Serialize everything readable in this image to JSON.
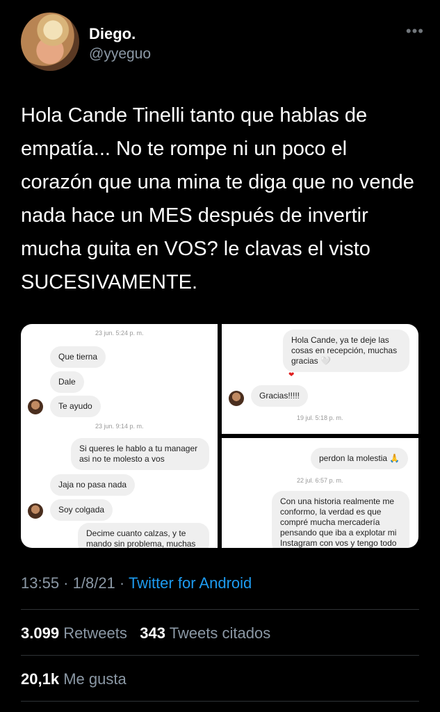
{
  "tweet": {
    "author_name": "Diego.",
    "author_handle": "@yyeguo",
    "more_icon": "more-horizontal-icon",
    "text": "Hola Cande Tinelli tanto que hablas de empatía... No te rompe ni un poco el corazón que una mina te diga que no vende nada hace un MES después de invertir mucha guita en VOS? le clavas el visto SUCESIVAMENTE.",
    "time": "13:55",
    "date": "1/8/21",
    "source": "Twitter for Android",
    "retweets_count": "3.099",
    "retweets_label": "Retweets",
    "quotes_count": "343",
    "quotes_label": "Tweets citados",
    "likes_count": "20,1k",
    "likes_label": "Me gusta"
  },
  "screenshot_a": {
    "ts1": "23 jun. 5:24 p. m.",
    "m1": "Que tierna",
    "m2": "Dale",
    "m3": "Te ayudo",
    "ts2": "23 jun. 9:14 p. m.",
    "m4": "Si queres le hablo a tu manager asi no te molesto a vos",
    "m5": "Jaja no pasa nada",
    "m6": "Soy colgada",
    "m7": "Decime cuanto calzas, y te mando sin problema, muchas"
  },
  "screenshot_b": {
    "m1": "Hola Cande, ya te deje las cosas en recepción, muchas gracias 🤍",
    "m2": "Gracias!!!!!",
    "ts1": "19 jul. 5:18 p. m."
  },
  "screenshot_c": {
    "m1": "perdon la molestia",
    "m1_emoji": "🙏",
    "ts1": "22 jul. 6:57 p. m.",
    "m2": "Con una historia realmente me conformo, la verdad es que compré mucha mercadería pensando que iba a explotar mi Instagram con vos y tengo todo"
  }
}
